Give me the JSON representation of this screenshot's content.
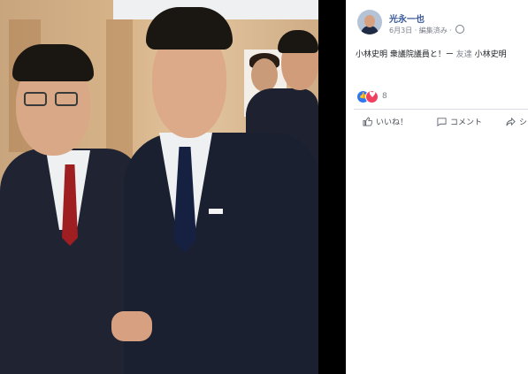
{
  "post": {
    "author": "光永一也",
    "meta": "6月3日 · 編集済み · ",
    "text_main": "小林史明 衆議院議員と！ー",
    "text_friend": "友達",
    "text_tag": "小林史明",
    "reaction_count": "8"
  },
  "actions": {
    "like": "いいね！",
    "comment": "コメント",
    "share": "シ"
  },
  "icons": {
    "globe": "globe-icon",
    "like": "thumbs-up-icon",
    "love": "heart-icon",
    "comment": "comment-icon",
    "share": "share-icon"
  },
  "colors": {
    "author_link": "#385898",
    "like_blue": "#2f77f1",
    "love_red": "#f0405e"
  }
}
